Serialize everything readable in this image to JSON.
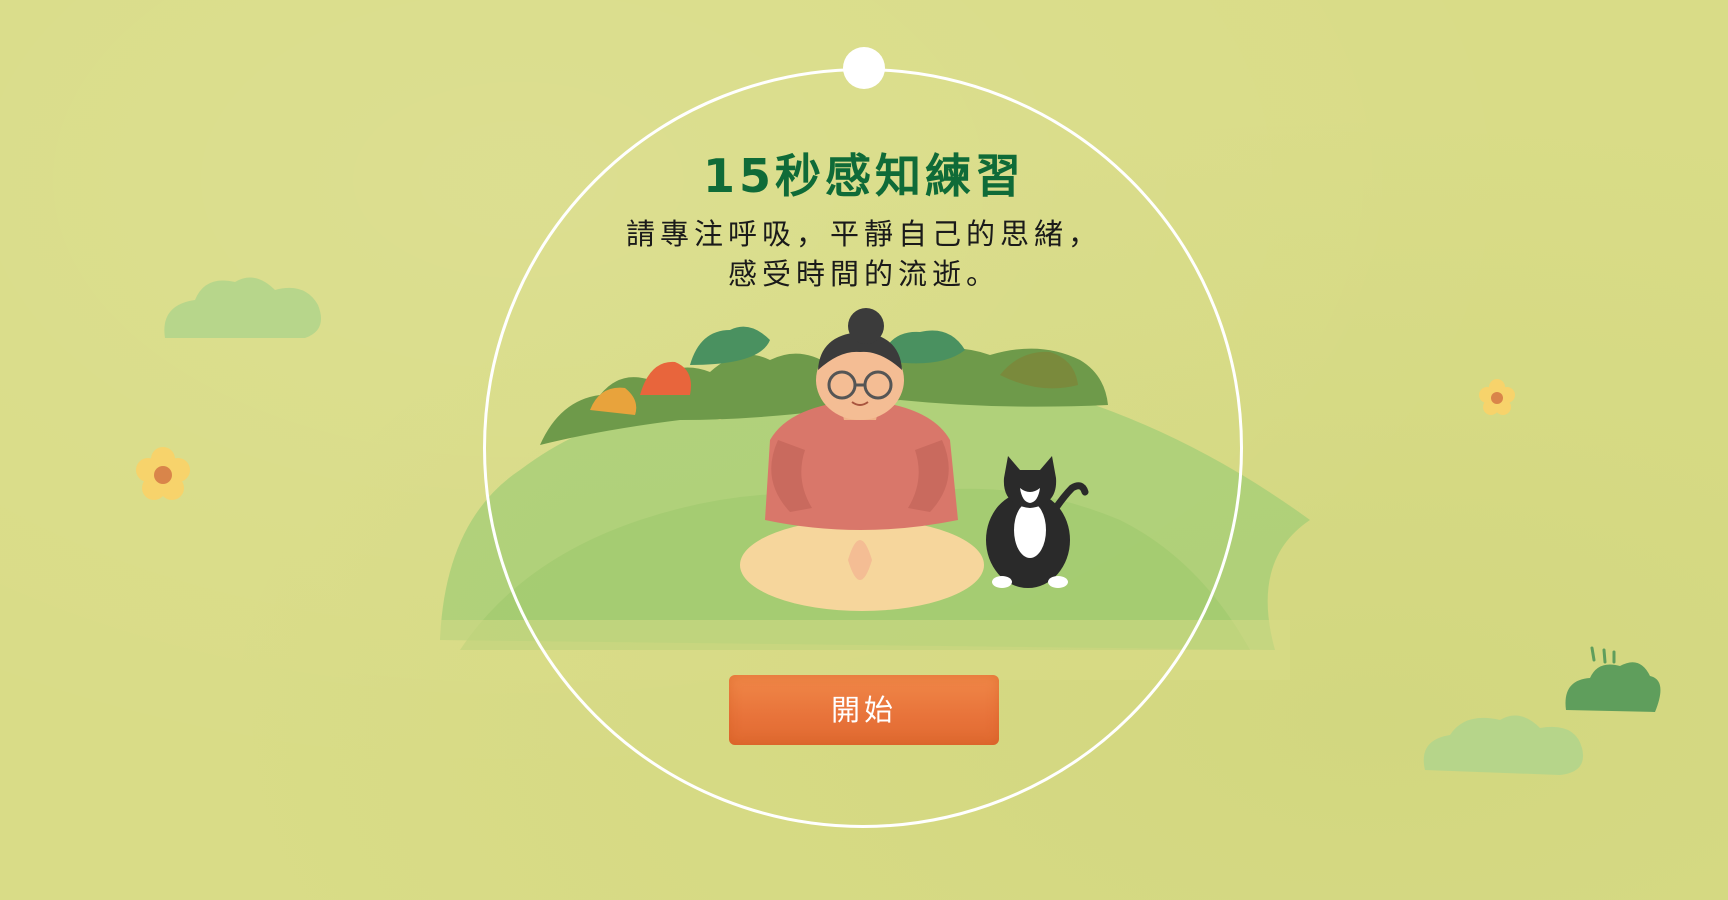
{
  "exercise": {
    "title": "15秒感知練習",
    "instruction_lines": [
      "請專注呼吸，平靜自己的思緒，",
      "感受時間的流逝。"
    ],
    "start_label": "開始"
  },
  "colors": {
    "background": "#d9dc87",
    "title": "#0f6b38",
    "button": "#e8733a",
    "ring": "#ffffff"
  },
  "icons": [
    "meditating-woman-icon",
    "tuxedo-cat-icon",
    "flower-icon",
    "cloud-icon",
    "bush-icon"
  ]
}
